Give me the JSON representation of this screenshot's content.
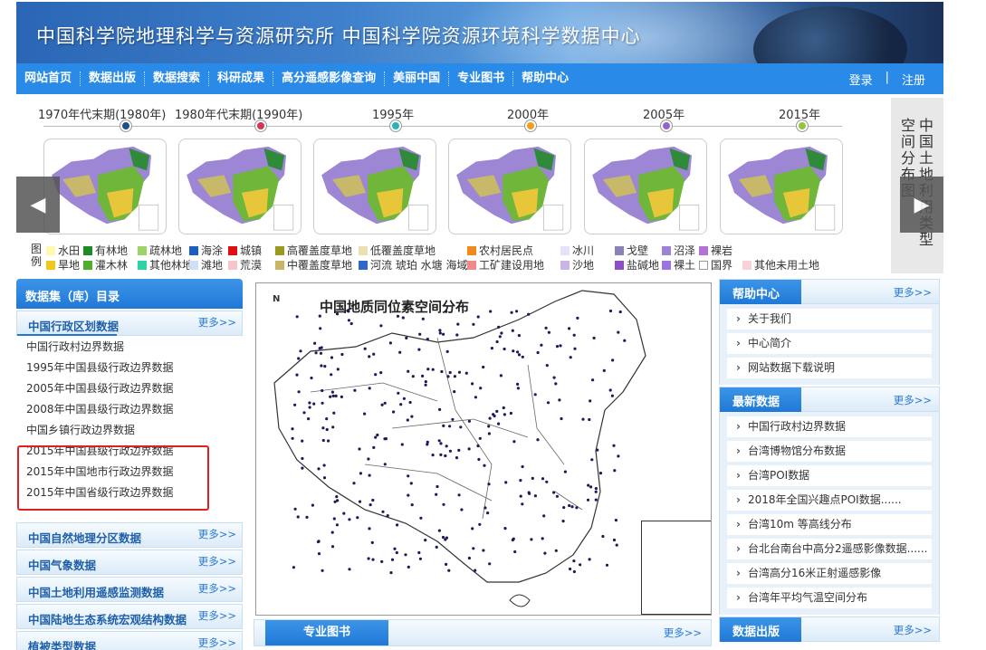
{
  "banner": {
    "title": "中国科学院地理科学与资源研究所  中国科学院资源环境科学数据中心"
  },
  "nav": {
    "items": [
      "网站首页",
      "数据出版",
      "数据搜索",
      "科研成果",
      "高分遥感影像查询",
      "美丽中国",
      "专业图书",
      "帮助中心"
    ],
    "login": "登录",
    "separator": "|",
    "register": "注册"
  },
  "timeline": {
    "periods": [
      {
        "label": "1970年代末期(1980年)",
        "color": "#1e4f8c"
      },
      {
        "label": "1980年代末期(1990年)",
        "color": "#d9345a"
      },
      {
        "label": "1995年",
        "color": "#2ab3b8"
      },
      {
        "label": "2000年",
        "color": "#f0a01f"
      },
      {
        "label": "2005年",
        "color": "#9a63c9"
      },
      {
        "label": "2015年",
        "color": "#93c53b"
      }
    ],
    "side_title_col1": "中国土地利用类型",
    "side_title_col2": "空间分布图"
  },
  "legend": {
    "title": "图例",
    "row1": [
      {
        "label": "水田",
        "color": "#fff8b0"
      },
      {
        "label": "有林地",
        "color": "#1f8a2a"
      },
      {
        "label": "疏林地",
        "color": "#9ed36a"
      },
      {
        "label": "海涂",
        "color": "#1a5fbf"
      },
      {
        "label": "城镇",
        "color": "#e01010"
      },
      {
        "label": "高覆盖度草地",
        "color": "#9a9a1e"
      },
      {
        "label": "低覆盖度草地",
        "color": "#e9e2b0"
      },
      {
        "label": "农村居民点",
        "color": "#f08a1c"
      },
      {
        "label": "冰川",
        "color": "#e4e4f8"
      },
      {
        "label": "戈壁",
        "color": "#8a82b8"
      },
      {
        "label": "沼泽",
        "color": "#9b84d6"
      },
      {
        "label": "裸岩",
        "color": "#b372d2"
      }
    ],
    "row2": [
      {
        "label": "旱地",
        "color": "#f2c81a"
      },
      {
        "label": "灌木林",
        "color": "#4fae2a"
      },
      {
        "label": "其他林地",
        "color": "#2fd2a2"
      },
      {
        "label": "滩地",
        "color": "#cfe0f6"
      },
      {
        "label": "荒漠",
        "color": "#f4c6cc"
      },
      {
        "label": "中覆盖度草地",
        "color": "#c7b56a"
      },
      {
        "label": "河流 琥珀 水塘 海域",
        "color": "#2e69c8"
      },
      {
        "label": "工矿建设用地",
        "color": "#f08a8a"
      },
      {
        "label": "沙地",
        "color": "#c9b5e8"
      },
      {
        "label": "盐碱地",
        "color": "#8e4fc6"
      },
      {
        "label": "裸土",
        "color": "#9a74e0"
      },
      {
        "label": "国界",
        "color": "#ffffff"
      },
      {
        "label": "其他未用土地",
        "color": "#f8d2d8"
      }
    ]
  },
  "catalog": {
    "title": "数据集（库）目录",
    "more": "更多>>",
    "first_category": "中国行政区划数据",
    "items": [
      "中国行政村边界数据",
      "1995年中国县级行政边界数据",
      "2005年中国县级行政边界数据",
      "2008年中国县级行政边界数据",
      "中国乡镇行政边界数据",
      "2015年中国县级行政边界数据",
      "2015年中国地市行政边界数据",
      "2015年中国省级行政边界数据"
    ],
    "categories": [
      "中国自然地理分区数据",
      "中国气象数据",
      "中国土地利用遥感监测数据",
      "中国陆地生态系统宏观结构数据",
      "植被类型数据"
    ]
  },
  "map": {
    "title": "中国地质同位素空间分布",
    "north": "N"
  },
  "books": {
    "title": "专业图书",
    "more": "更多>>"
  },
  "help": {
    "title": "帮助中心",
    "more": "更多>>",
    "items": [
      "关于我们",
      "中心简介",
      "网站数据下载说明"
    ]
  },
  "latest": {
    "title": "最新数据",
    "more": "更多>>",
    "items": [
      "中国行政村边界数据",
      "台湾博物馆分布数据",
      "台湾POI数据",
      "2018年全国兴趣点POI数据......",
      "台湾10m 等高线分布",
      "台北台南台中高分2遥感影像数据......",
      "台湾高分16米正射遥感影像",
      "台湾年平均气温空间分布"
    ]
  },
  "publish": {
    "title": "数据出版",
    "more": "更多>>"
  }
}
